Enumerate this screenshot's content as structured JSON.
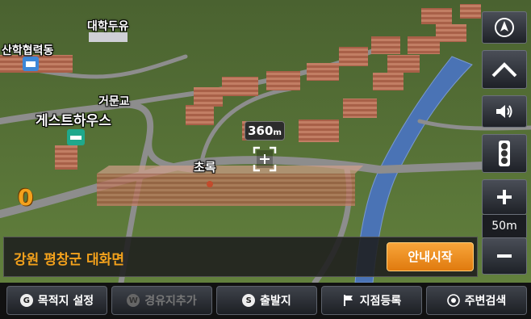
{
  "map": {
    "poi_labels": {
      "daehak_duyu": "대학두유",
      "sanhak_hyeopryeokdong": "산학협력동",
      "guesthouse": "게스트하우스",
      "geomungyo": "거문교",
      "chorok": "초록"
    },
    "distance_value": "360",
    "distance_unit": "m",
    "speed": "0",
    "scale": "50m"
  },
  "address": {
    "text": "강원 평창군 대화면",
    "start_label": "안내시작"
  },
  "bottom": [
    {
      "icon_letter": "G",
      "label": "목적지 설정",
      "enabled": true
    },
    {
      "icon_letter": "W",
      "label": "경유지추가",
      "enabled": false
    },
    {
      "icon_letter": "S",
      "label": "출발지",
      "enabled": true
    },
    {
      "icon_letter": "",
      "label": "지점등록",
      "enabled": true
    },
    {
      "icon_letter": "",
      "label": "주변검색",
      "enabled": true
    }
  ],
  "colors": {
    "grass": "#5f7a3c",
    "road": "#8d8d8d",
    "river": "#4a73b5",
    "accent_orange": "#f3a11c"
  }
}
